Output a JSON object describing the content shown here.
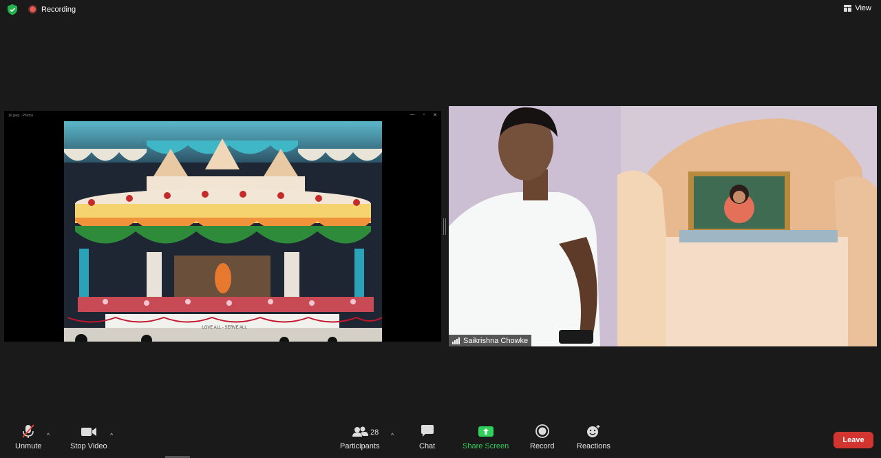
{
  "topbar": {
    "recording_label": "Recording",
    "view_label": "View"
  },
  "share": {
    "window_title": "1k.jpeg - Photos",
    "sign_text": "LOVE ALL - SERVE ALL"
  },
  "participant": {
    "name": "Saikrishna Chowke"
  },
  "toolbar": {
    "unmute_label": "Unmute",
    "stop_video_label": "Stop Video",
    "participants_label": "Participants",
    "participants_count": "28",
    "chat_label": "Chat",
    "share_screen_label": "Share Screen",
    "record_label": "Record",
    "reactions_label": "Reactions",
    "leave_label": "Leave"
  },
  "colors": {
    "background": "#1a1a1a",
    "share_green": "#2fd15a",
    "leave_red": "#d2352f",
    "recording_red": "#e35c52"
  }
}
